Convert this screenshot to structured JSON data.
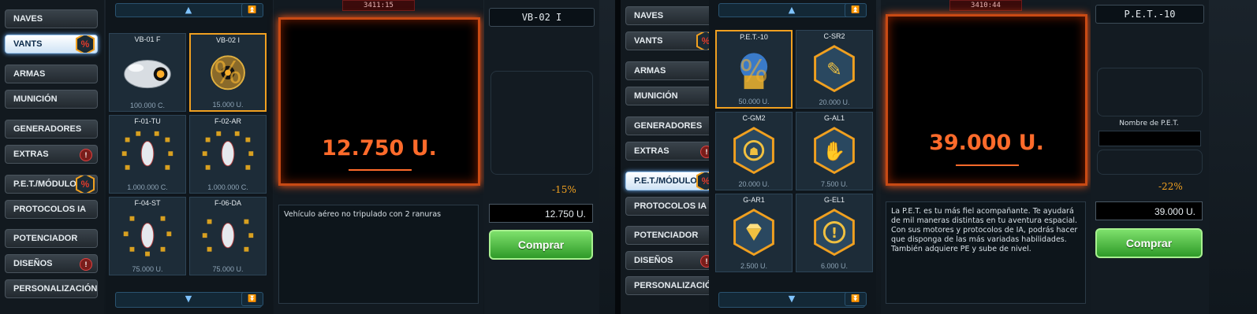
{
  "panels": [
    {
      "sidebar": [
        {
          "label": "NAVES",
          "badge": "",
          "alert": false
        },
        {
          "label": "VANTS",
          "badge": "%",
          "alert": false,
          "active": true
        },
        {
          "label": "ARMAS",
          "badge": "",
          "alert": false
        },
        {
          "label": "MUNICIÓN",
          "badge": "",
          "alert": false
        },
        {
          "label": "GENERADORES",
          "badge": "",
          "alert": false
        },
        {
          "label": "EXTRAS",
          "badge": "",
          "alert": true
        },
        {
          "label": "P.E.T./MÓDULOS",
          "badge": "%",
          "alert": false
        },
        {
          "label": "PROTOCOLOS IA",
          "badge": "",
          "alert": false
        },
        {
          "label": "POTENCIADOR",
          "badge": "",
          "alert": false
        },
        {
          "label": "DISEÑOS",
          "badge": "",
          "alert": true
        },
        {
          "label": "PERSONALIZACIÓN",
          "badge": "",
          "alert": false
        }
      ],
      "items": [
        {
          "name": "VB-01 F",
          "price": "100.000 C.",
          "icon": "drone-icon"
        },
        {
          "name": "VB-02 I",
          "price": "15.000 U.",
          "icon": "drone-discount-icon",
          "selected": true
        },
        {
          "name": "F-01-TU",
          "price": "1.000.000 C.",
          "icon": "formation-icon"
        },
        {
          "name": "F-02-AR",
          "price": "1.000.000 C.",
          "icon": "formation-icon"
        },
        {
          "name": "F-04-ST",
          "price": "75.000 U.",
          "icon": "formation-icon"
        },
        {
          "name": "F-06-DA",
          "price": "75.000 U.",
          "icon": "formation-icon"
        }
      ],
      "timer": "3411:15",
      "preview_price": "12.750 U.",
      "description": "Vehículo aéreo no tripulado con 2 ranuras",
      "title": "VB-02 I",
      "discount": "-15%",
      "price_field": "12.750 U.",
      "buy_label": "Comprar"
    },
    {
      "sidebar": [
        {
          "label": "NAVES",
          "badge": "",
          "alert": false
        },
        {
          "label": "VANTS",
          "badge": "%",
          "alert": false
        },
        {
          "label": "ARMAS",
          "badge": "",
          "alert": false
        },
        {
          "label": "MUNICIÓN",
          "badge": "",
          "alert": false
        },
        {
          "label": "GENERADORES",
          "badge": "",
          "alert": false
        },
        {
          "label": "EXTRAS",
          "badge": "",
          "alert": true
        },
        {
          "label": "P.E.T./MÓDULOS",
          "badge": "%",
          "alert": false,
          "active": true
        },
        {
          "label": "PROTOCOLOS IA",
          "badge": "",
          "alert": false
        },
        {
          "label": "POTENCIADOR",
          "badge": "",
          "alert": false
        },
        {
          "label": "DISEÑOS",
          "badge": "",
          "alert": true
        },
        {
          "label": "PERSONALIZACIÓN",
          "badge": "",
          "alert": false
        }
      ],
      "items": [
        {
          "name": "P.E.T.-10",
          "price": "50.000 U.",
          "icon": "pet-robot-icon",
          "selected": true
        },
        {
          "name": "C-SR2",
          "price": "20.000 U.",
          "icon": "wrench-hex-icon"
        },
        {
          "name": "C-GM2",
          "price": "20.000 U.",
          "icon": "bug-hex-icon"
        },
        {
          "name": "G-AL1",
          "price": "7.500 U.",
          "icon": "hand-hex-icon"
        },
        {
          "name": "G-AR1",
          "price": "2.500 U.",
          "icon": "gem-hex-icon"
        },
        {
          "name": "G-EL1",
          "price": "6.000 U.",
          "icon": "exclamation-hex-icon"
        }
      ],
      "timer": "3410:44",
      "preview_price": "39.000 U.",
      "description": "La P.E.T. es tu más fiel acompañante. Te ayudará de mil maneras distintas en tu aventura espacial. Con sus motores y protocolos de IA, podrás hacer que disponga de las más variadas habilidades. También adquiere PE y sube de nivel.",
      "title": "P.E.T.-10",
      "pet_name_label": "Nombre de P.E.T.",
      "discount": "-22%",
      "price_field": "39.000 U.",
      "buy_label": "Comprar"
    }
  ],
  "colors": {
    "accent_orange": "#ff6b2b",
    "discount": "#f0a020",
    "buy_green": "#4cc13c"
  }
}
